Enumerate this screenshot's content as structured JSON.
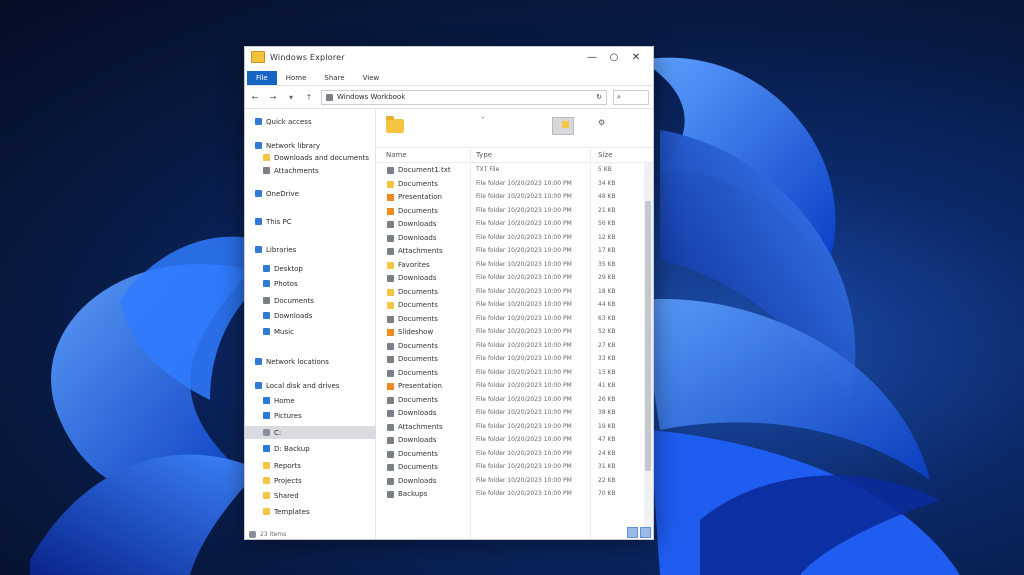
{
  "window": {
    "title": "Windows Explorer"
  },
  "ribbon": {
    "tabs": [
      "File",
      "Home",
      "Share",
      "View"
    ]
  },
  "nav": {
    "back_icon": "back-arrow-icon",
    "forward_icon": "forward-arrow-icon",
    "address": "Windows Workbook",
    "search_glyph": "⌕"
  },
  "sidebar": {
    "items": [
      {
        "label": "Quick access",
        "icon": "blue",
        "indent": 0
      },
      {
        "label": "Network library",
        "icon": "blue",
        "indent": 0
      },
      {
        "label": "Downloads and documents",
        "icon": "folder",
        "indent": 1
      },
      {
        "label": "Attachments",
        "icon": "gray",
        "indent": 1
      },
      {
        "label": "OneDrive",
        "icon": "blue",
        "indent": 0
      },
      {
        "label": "This PC",
        "icon": "blue",
        "indent": 0
      },
      {
        "label": "Libraries",
        "icon": "blue",
        "indent": 0
      },
      {
        "label": "Desktop",
        "icon": "blue",
        "indent": 1
      },
      {
        "label": "Photos",
        "icon": "blue",
        "indent": 1
      },
      {
        "label": "Documents",
        "icon": "gray",
        "indent": 1
      },
      {
        "label": "Downloads",
        "icon": "blue",
        "indent": 1
      },
      {
        "label": "Music",
        "icon": "blue",
        "indent": 1
      },
      {
        "label": "Network locations",
        "icon": "blue",
        "indent": 0
      },
      {
        "label": "Local disk and drives",
        "icon": "blue",
        "indent": 0
      },
      {
        "label": "Home",
        "icon": "blue",
        "indent": 1
      },
      {
        "label": "Pictures",
        "icon": "blue",
        "indent": 1
      },
      {
        "label": "C:",
        "icon": "drive",
        "indent": 1,
        "selected": true
      },
      {
        "label": "D: Backup",
        "icon": "blue",
        "indent": 1
      },
      {
        "label": "Reports",
        "icon": "folder",
        "indent": 1
      },
      {
        "label": "Projects",
        "icon": "folder",
        "indent": 1
      },
      {
        "label": "Shared",
        "icon": "folder",
        "indent": 1
      },
      {
        "label": "Templates",
        "icon": "folder",
        "indent": 1
      }
    ],
    "status": "23 items"
  },
  "list": {
    "headers": {
      "name": "Name",
      "type": "Type",
      "size": "Size"
    },
    "rows": [
      {
        "icon": "gray",
        "name": "Document1.txt",
        "type": "TXT File",
        "size": "5 KB"
      },
      {
        "icon": "folder",
        "name": "Documents",
        "type": "File folder 10/20/2023 10:00 PM",
        "size": "34 KB"
      },
      {
        "icon": "orange",
        "name": "Presentation",
        "type": "File folder 10/20/2023 10:00 PM",
        "size": "48 KB"
      },
      {
        "icon": "orange",
        "name": "Documents",
        "type": "File folder 10/20/2023 10:00 PM",
        "size": "21 KB"
      },
      {
        "icon": "gray",
        "name": "Downloads",
        "type": "File folder 10/20/2023 10:00 PM",
        "size": "56 KB"
      },
      {
        "icon": "gray",
        "name": "Downloads",
        "type": "File folder 10/20/2023 10:00 PM",
        "size": "12 KB"
      },
      {
        "icon": "gray",
        "name": "Attachments",
        "type": "File folder 10/20/2023 10:00 PM",
        "size": "17 KB"
      },
      {
        "icon": "folder",
        "name": "Favorites",
        "type": "File folder 10/20/2023 10:00 PM",
        "size": "35 KB"
      },
      {
        "icon": "gray",
        "name": "Downloads",
        "type": "File folder 10/20/2023 10:00 PM",
        "size": "29 KB"
      },
      {
        "icon": "folder",
        "name": "Documents",
        "type": "File folder 10/20/2023 10:00 PM",
        "size": "18 KB"
      },
      {
        "icon": "folder",
        "name": "Documents",
        "type": "File folder 10/20/2023 10:00 PM",
        "size": "44 KB"
      },
      {
        "icon": "gray",
        "name": "Documents",
        "type": "File folder 10/20/2023 10:00 PM",
        "size": "63 KB"
      },
      {
        "icon": "orange",
        "name": "Slideshow",
        "type": "File folder 10/20/2023 10:00 PM",
        "size": "52 KB"
      },
      {
        "icon": "gray",
        "name": "Documents",
        "type": "File folder 10/20/2023 10:00 PM",
        "size": "27 KB"
      },
      {
        "icon": "gray",
        "name": "Documents",
        "type": "File folder 10/20/2023 10:00 PM",
        "size": "33 KB"
      },
      {
        "icon": "gray",
        "name": "Documents",
        "type": "File folder 10/20/2023 10:00 PM",
        "size": "15 KB"
      },
      {
        "icon": "orange",
        "name": "Presentation",
        "type": "File folder 10/20/2023 10:00 PM",
        "size": "41 KB"
      },
      {
        "icon": "gray",
        "name": "Documents",
        "type": "File folder 10/20/2023 10:00 PM",
        "size": "26 KB"
      },
      {
        "icon": "gray",
        "name": "Downloads",
        "type": "File folder 10/20/2023 10:00 PM",
        "size": "38 KB"
      },
      {
        "icon": "gray",
        "name": "Attachments",
        "type": "File folder 10/20/2023 10:00 PM",
        "size": "19 KB"
      },
      {
        "icon": "gray",
        "name": "Downloads",
        "type": "File folder 10/20/2023 10:00 PM",
        "size": "47 KB"
      },
      {
        "icon": "gray",
        "name": "Documents",
        "type": "File folder 10/20/2023 10:00 PM",
        "size": "24 KB"
      },
      {
        "icon": "gray",
        "name": "Documents",
        "type": "File folder 10/20/2023 10:00 PM",
        "size": "31 KB"
      },
      {
        "icon": "gray",
        "name": "Downloads",
        "type": "File folder 10/20/2023 10:00 PM",
        "size": "22 KB"
      },
      {
        "icon": "gray",
        "name": "Backups",
        "type": "File folder 10/20/2023 10:00 PM",
        "size": "70 KB"
      }
    ]
  },
  "colors": {
    "accent": "#1764c5",
    "folder": "#f4c542",
    "wallpaper": "#0b2a6b"
  }
}
